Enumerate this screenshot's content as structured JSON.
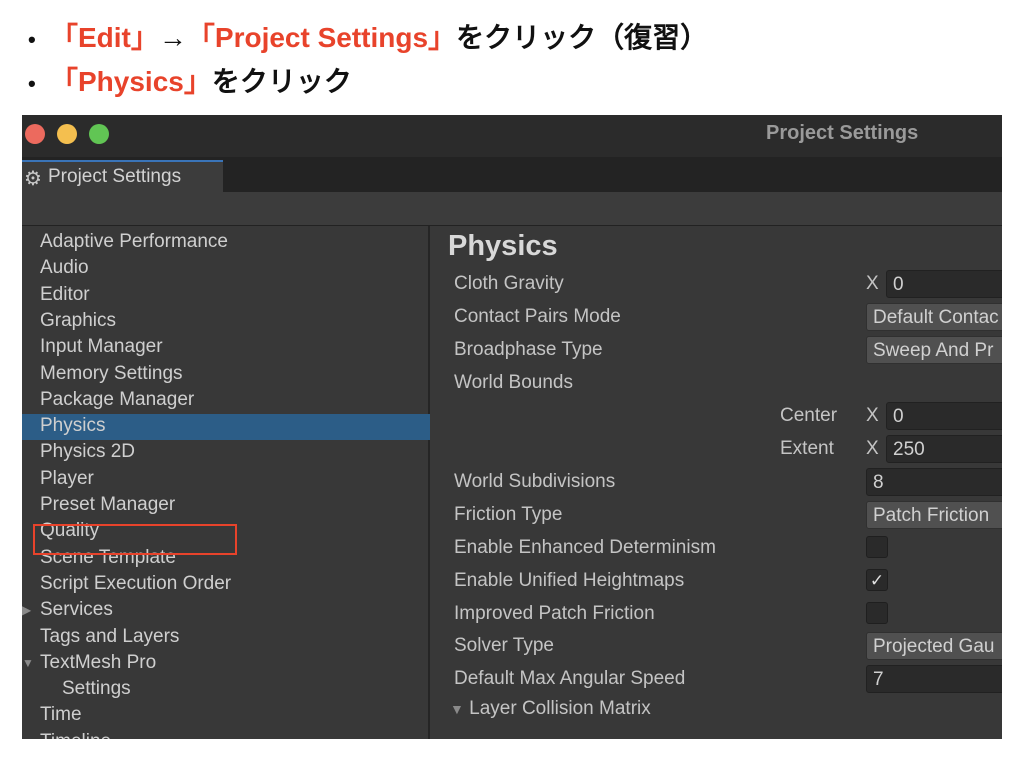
{
  "instructions": [
    {
      "parts": [
        {
          "text": "「Edit」",
          "red": true
        },
        {
          "text": "→",
          "red": false
        },
        {
          "text": "「Project Settings」",
          "red": true
        },
        {
          "text": "をクリック（復習）",
          "red": false
        }
      ]
    },
    {
      "parts": [
        {
          "text": "「Physics」",
          "red": true
        },
        {
          "text": "をクリック",
          "red": false
        }
      ]
    }
  ],
  "colors": {
    "highlight": "#e8432b",
    "selection": "#2c5d87",
    "tab_accent": "#3a74b8"
  },
  "window": {
    "title": "Project Settings",
    "tab_label": "Project Settings",
    "tab_icon": "gear-icon"
  },
  "sidebar": {
    "items": [
      {
        "label": "Adaptive Performance"
      },
      {
        "label": "Audio"
      },
      {
        "label": "Editor"
      },
      {
        "label": "Graphics"
      },
      {
        "label": "Input Manager"
      },
      {
        "label": "Memory Settings"
      },
      {
        "label": "Package Manager"
      },
      {
        "label": "Physics",
        "selected": true
      },
      {
        "label": "Physics 2D"
      },
      {
        "label": "Player"
      },
      {
        "label": "Preset Manager"
      },
      {
        "label": "Quality"
      },
      {
        "label": "Scene Template"
      },
      {
        "label": "Script Execution Order"
      },
      {
        "label": "Services",
        "expander": "collapsed"
      },
      {
        "label": "Tags and Layers"
      },
      {
        "label": "TextMesh Pro",
        "expander": "expanded"
      },
      {
        "label": "Settings",
        "child": true
      },
      {
        "label": "Time"
      },
      {
        "label": "Timeline"
      }
    ]
  },
  "main": {
    "title": "Physics",
    "cloth_gravity": {
      "label": "Cloth Gravity",
      "axis": "X",
      "value": "0"
    },
    "contact_pairs": {
      "label": "Contact Pairs Mode",
      "value": "Default Contac"
    },
    "broadphase": {
      "label": "Broadphase Type",
      "value": "Sweep And Pr"
    },
    "world_bounds": {
      "label": "World Bounds",
      "center": {
        "label": "Center",
        "axis": "X",
        "value": "0"
      },
      "extent": {
        "label": "Extent",
        "axis": "X",
        "value": "250"
      }
    },
    "world_subdivisions": {
      "label": "World Subdivisions",
      "value": "8"
    },
    "friction_type": {
      "label": "Friction Type",
      "value": "Patch Friction"
    },
    "enhanced_determinism": {
      "label": "Enable Enhanced Determinism",
      "checked": false
    },
    "unified_heightmaps": {
      "label": "Enable Unified Heightmaps",
      "checked": true,
      "mark": "✓"
    },
    "improved_patch": {
      "label": "Improved Patch Friction",
      "checked": false
    },
    "solver_type": {
      "label": "Solver Type",
      "value": "Projected Gau"
    },
    "max_angular": {
      "label": "Default Max Angular Speed",
      "value": "7"
    },
    "layer_matrix": {
      "label": "Layer Collision Matrix"
    }
  }
}
